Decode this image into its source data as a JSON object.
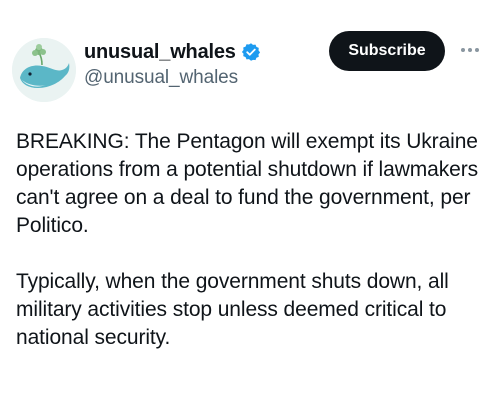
{
  "post": {
    "author": {
      "display_name": "unusual_whales",
      "handle": "@unusual_whales",
      "verified": true,
      "avatar_icon": "whale-avatar-icon"
    },
    "subscribe_label": "Subscribe",
    "more_icon": "more-horizontal-icon",
    "paragraphs": [
      "BREAKING: The Pentagon will exempt its Ukraine operations from a potential shutdown if lawmakers can't agree on a deal to fund the government, per Politico.",
      "Typically, when the government shuts down, all military activities stop unless deemed critical to national security."
    ]
  },
  "colors": {
    "verified_badge": "#1d9bf0",
    "button_bg": "#0f1419",
    "handle_text": "#536471"
  }
}
